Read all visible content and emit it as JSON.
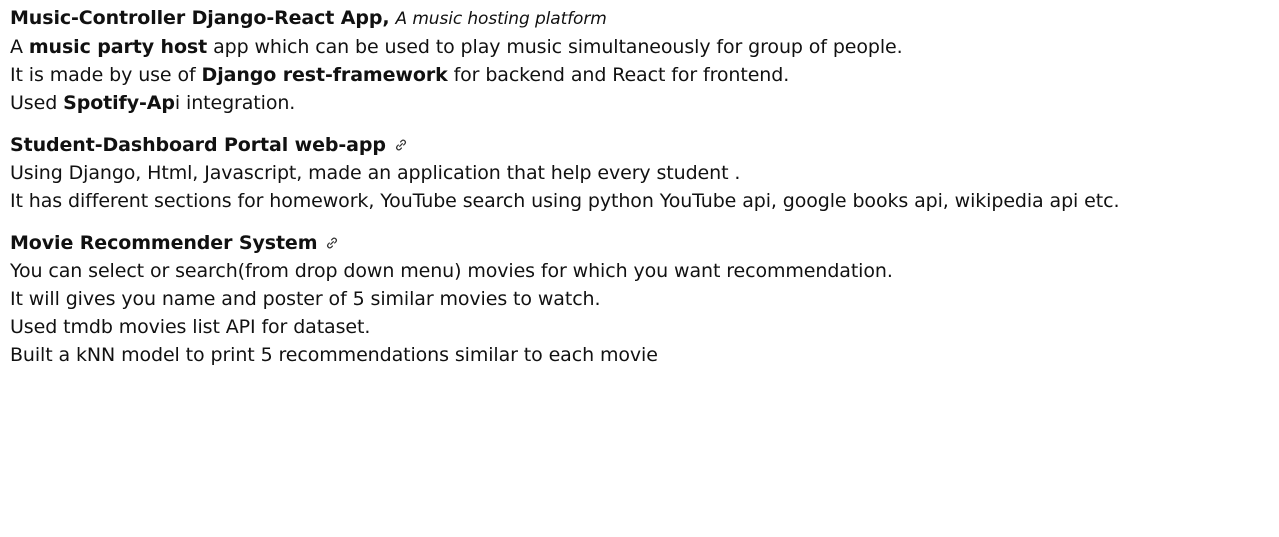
{
  "projects": [
    {
      "title": "Music-Controller Django-React App,",
      "subtitle": "A music hosting platform",
      "lines": [
        [
          "A ",
          "music party host",
          " app which can be used to play music simultaneously for group of people."
        ],
        [
          "It is made by use of ",
          "Django rest-framework",
          " for backend and React for frontend."
        ],
        [
          "Used ",
          "Spotify-Ap",
          "i integration."
        ]
      ]
    },
    {
      "title": "Student-Dashboard Portal web-app",
      "link_icon": "link-icon",
      "lines": [
        "Using Django, Html, Javascript, made an application that help every student .",
        "It has different sections for homework, YouTube search using python YouTube api, google books api, wikipedia api etc."
      ]
    },
    {
      "title": "Movie Recommender System",
      "link_icon": "link-icon",
      "lines": [
        "You can select or search(from drop down menu) movies for which you want recommendation.",
        "It will gives you name and poster of 5 similar movies to watch.",
        "Used tmdb movies list API for dataset.",
        "Built a kNN model to print 5 recommendations similar to each movie"
      ]
    }
  ]
}
